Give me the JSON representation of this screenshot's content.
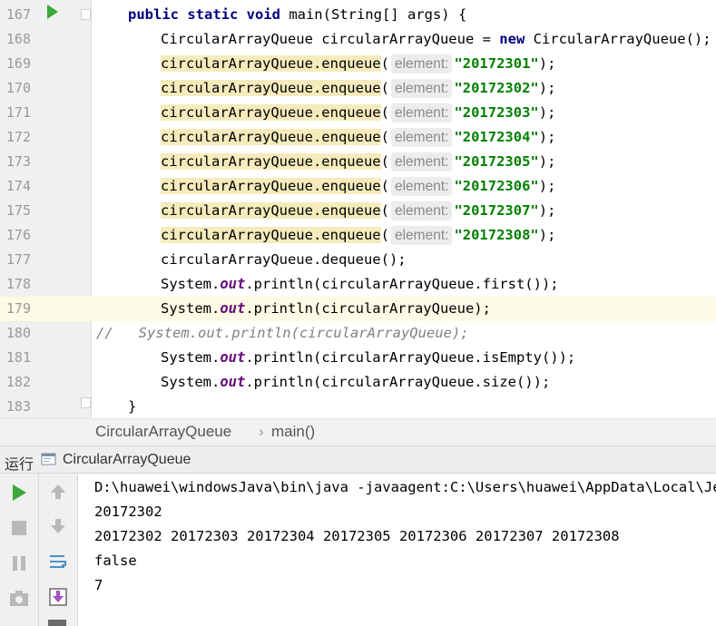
{
  "editor": {
    "lines": [
      {
        "num": "167",
        "indent": 1,
        "segs": [
          [
            "kw",
            "public static void "
          ],
          [
            "",
            "main(String[] args) {"
          ]
        ]
      },
      {
        "num": "168",
        "indent": 2,
        "segs": [
          [
            "",
            "CircularArrayQueue circularArrayQueue = "
          ],
          [
            "kw",
            "new "
          ],
          [
            "",
            "CircularArrayQueue();"
          ]
        ]
      },
      {
        "num": "169",
        "indent": 2,
        "segs": [
          [
            "hl",
            "circularArrayQueue.enqueue"
          ],
          [
            "",
            "("
          ],
          [
            "hint",
            "element:"
          ],
          [
            "str",
            "\"20172301\""
          ],
          [
            "",
            ");"
          ]
        ]
      },
      {
        "num": "170",
        "indent": 2,
        "segs": [
          [
            "hl",
            "circularArrayQueue.enqueue"
          ],
          [
            "",
            "("
          ],
          [
            "hint",
            "element:"
          ],
          [
            "str",
            "\"20172302\""
          ],
          [
            "",
            ");"
          ]
        ]
      },
      {
        "num": "171",
        "indent": 2,
        "segs": [
          [
            "hl",
            "circularArrayQueue.enqueue"
          ],
          [
            "",
            "("
          ],
          [
            "hint",
            "element:"
          ],
          [
            "str",
            "\"20172303\""
          ],
          [
            "",
            ");"
          ]
        ]
      },
      {
        "num": "172",
        "indent": 2,
        "segs": [
          [
            "hl",
            "circularArrayQueue.enqueue"
          ],
          [
            "",
            "("
          ],
          [
            "hint",
            "element:"
          ],
          [
            "str",
            "\"20172304\""
          ],
          [
            "",
            ");"
          ]
        ]
      },
      {
        "num": "173",
        "indent": 2,
        "segs": [
          [
            "hl",
            "circularArrayQueue.enqueue"
          ],
          [
            "",
            "("
          ],
          [
            "hint",
            "element:"
          ],
          [
            "str",
            "\"20172305\""
          ],
          [
            "",
            ");"
          ]
        ]
      },
      {
        "num": "174",
        "indent": 2,
        "segs": [
          [
            "hl",
            "circularArrayQueue.enqueue"
          ],
          [
            "",
            "("
          ],
          [
            "hint",
            "element:"
          ],
          [
            "str",
            "\"20172306\""
          ],
          [
            "",
            ");"
          ]
        ]
      },
      {
        "num": "175",
        "indent": 2,
        "segs": [
          [
            "hl",
            "circularArrayQueue.enqueue"
          ],
          [
            "",
            "("
          ],
          [
            "hint",
            "element:"
          ],
          [
            "str",
            "\"20172307\""
          ],
          [
            "",
            ");"
          ]
        ]
      },
      {
        "num": "176",
        "indent": 2,
        "segs": [
          [
            "hl",
            "circularArrayQueue.enqueue"
          ],
          [
            "",
            "("
          ],
          [
            "hint",
            "element:"
          ],
          [
            "str",
            "\"20172308\""
          ],
          [
            "",
            ");"
          ]
        ]
      },
      {
        "num": "177",
        "indent": 2,
        "segs": [
          [
            "",
            "circularArrayQueue.dequeue();"
          ]
        ]
      },
      {
        "num": "178",
        "indent": 2,
        "segs": [
          [
            "",
            "System."
          ],
          [
            "field",
            "out"
          ],
          [
            "",
            ".println(circularArrayQueue.first());"
          ]
        ]
      },
      {
        "num": "179",
        "indent": 2,
        "current": true,
        "segs": [
          [
            "",
            "System."
          ],
          [
            "field",
            "out"
          ],
          [
            "",
            ".println(circularArrayQueue);"
          ]
        ]
      },
      {
        "num": "180",
        "indent": 0,
        "segs": [
          [
            "comment-mark",
            "//"
          ],
          [
            "comment",
            "   System.out.println(circularArrayQueue);"
          ]
        ]
      },
      {
        "num": "181",
        "indent": 2,
        "segs": [
          [
            "",
            "System."
          ],
          [
            "field",
            "out"
          ],
          [
            "",
            ".println(circularArrayQueue.isEmpty());"
          ]
        ]
      },
      {
        "num": "182",
        "indent": 2,
        "segs": [
          [
            "",
            "System."
          ],
          [
            "field",
            "out"
          ],
          [
            "",
            ".println(circularArrayQueue.size());"
          ]
        ]
      },
      {
        "num": "183",
        "indent": 1,
        "segs": [
          [
            "",
            "}"
          ]
        ]
      }
    ]
  },
  "breadcrumb": {
    "class_name": "CircularArrayQueue",
    "separator": "›",
    "method": "main()"
  },
  "run_panel": {
    "tab_label": "运行",
    "config_name": "CircularArrayQueue",
    "output": [
      "D:\\huawei\\windowsJava\\bin\\java -javaagent:C:\\Users\\huawei\\AppData\\Local\\JetB",
      "20172302",
      "20172302 20172303 20172304 20172305 20172306 20172307 20172308",
      "false",
      "7"
    ]
  },
  "colors": {
    "keyword": "#000080",
    "string": "#008000",
    "static_field": "#660e7a",
    "usage_highlight": "#f6ebbc",
    "run_green": "#3aa83a"
  }
}
